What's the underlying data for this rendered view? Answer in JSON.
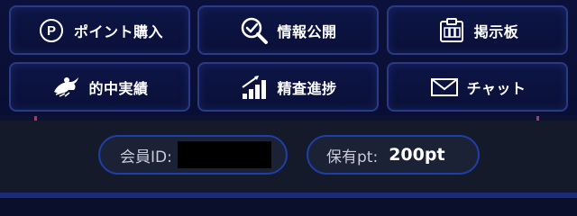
{
  "menu": {
    "items": [
      {
        "label": "ポイント購入",
        "icon": "point-coin-icon"
      },
      {
        "label": "情報公開",
        "icon": "magnifier-check-icon"
      },
      {
        "label": "掲示板",
        "icon": "clipboard-icon"
      },
      {
        "label": "的中実績",
        "icon": "horse-racing-icon"
      },
      {
        "label": "精査進捗",
        "icon": "progress-bars-icon"
      },
      {
        "label": "チャット",
        "icon": "envelope-icon"
      }
    ]
  },
  "account": {
    "id_label": "会員ID:",
    "points_label": "保有pt:",
    "points_value": "200pt"
  },
  "colors": {
    "background": "#0a0f2c",
    "button_border": "#2a3a86",
    "pill_border": "#1f3fa8",
    "bottom_bar": "#151a2b"
  }
}
